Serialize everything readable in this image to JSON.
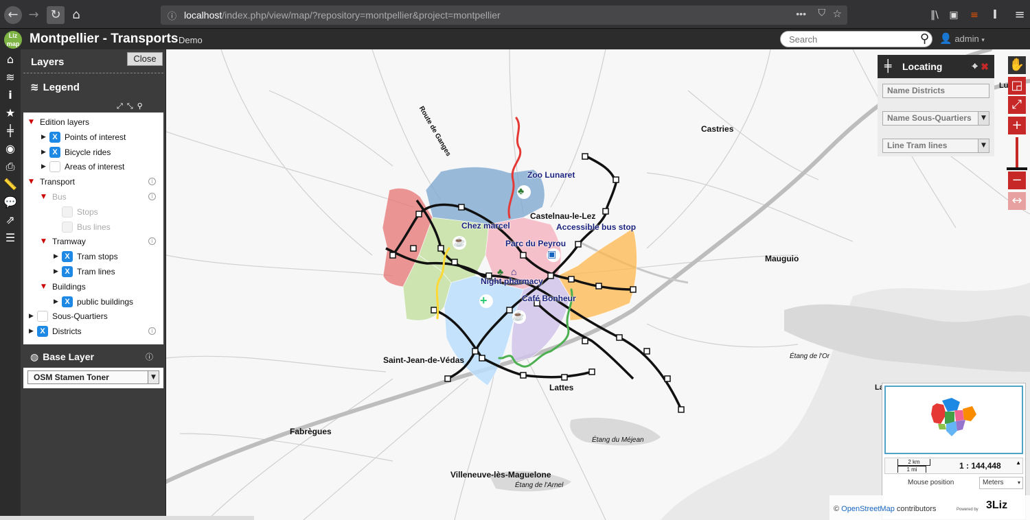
{
  "browser": {
    "url_host": "localhost",
    "url_path": "/index.php/view/map/?repository=montpellier&project=montpellier"
  },
  "app": {
    "logo_text": "Liz map",
    "title": "Montpellier - Transports",
    "subtitle": "Demo",
    "search_placeholder": "Search",
    "user": "admin"
  },
  "panel": {
    "title": "Layers",
    "close_label": "Close",
    "legend_title": "Legend",
    "tree": [
      {
        "label": "Edition layers",
        "level": 0,
        "state": "open",
        "checkbox": null,
        "info": false,
        "greyed": false
      },
      {
        "label": "Points of interest",
        "level": 1,
        "state": "closed",
        "checkbox": "on",
        "info": false,
        "greyed": false
      },
      {
        "label": "Bicycle rides",
        "level": 1,
        "state": "closed",
        "checkbox": "on",
        "info": false,
        "greyed": false
      },
      {
        "label": "Areas of interest",
        "level": 1,
        "state": "closed",
        "checkbox": "off",
        "info": false,
        "greyed": false
      },
      {
        "label": "Transport",
        "level": 0,
        "state": "open",
        "checkbox": null,
        "info": true,
        "greyed": false
      },
      {
        "label": "Bus",
        "level": 1,
        "state": "open",
        "checkbox": null,
        "info": true,
        "greyed": true
      },
      {
        "label": "Stops",
        "level": 2,
        "state": "none",
        "checkbox": "disabled",
        "info": false,
        "greyed": true
      },
      {
        "label": "Bus lines",
        "level": 2,
        "state": "none",
        "checkbox": "disabled",
        "info": false,
        "greyed": true
      },
      {
        "label": "Tramway",
        "level": 1,
        "state": "open",
        "checkbox": null,
        "info": true,
        "greyed": false
      },
      {
        "label": "Tram stops",
        "level": 2,
        "state": "closed",
        "checkbox": "on",
        "info": false,
        "greyed": false
      },
      {
        "label": "Tram lines",
        "level": 2,
        "state": "closed",
        "checkbox": "on",
        "info": false,
        "greyed": false
      },
      {
        "label": "Buildings",
        "level": 1,
        "state": "open",
        "checkbox": null,
        "info": false,
        "greyed": false
      },
      {
        "label": "public buildings",
        "level": 2,
        "state": "closed",
        "checkbox": "on",
        "info": false,
        "greyed": false
      },
      {
        "label": "Sous-Quartiers",
        "level": 0,
        "state": "closed",
        "checkbox": "off",
        "info": false,
        "greyed": false
      },
      {
        "label": "Districts",
        "level": 0,
        "state": "closed",
        "checkbox": "on",
        "info": true,
        "greyed": false
      }
    ],
    "base_layer_title": "Base Layer",
    "base_layer_value": "OSM Stamen Toner"
  },
  "locating": {
    "title": "Locating",
    "fields": [
      "Name Districts",
      "Name Sous-Quartiers",
      "Line Tram lines"
    ]
  },
  "map": {
    "places": [
      "Castries",
      "Mauguio",
      "Saint-Jean-de-Védas",
      "Lattes",
      "Fabrègues",
      "Villeneuve-lès-Maguelone",
      "Castelnau-le-Lez",
      "Route de Ganges",
      "Lunel",
      "La"
    ],
    "water": [
      "Étang de l'Or",
      "Étang du Méjean",
      "Étang de l'Arnel"
    ],
    "pois": [
      "Zoo Lunaret",
      "Chez marcel",
      "Parc du Peyrou",
      "Accessible bus stop",
      "Night pharmacy",
      "Café Bonheur"
    ]
  },
  "overview": {
    "scale_km": "2 km",
    "scale_mi": "1 mi",
    "scale_ratio": "1 : 144,448",
    "mouse_label": "Mouse position",
    "units": "Meters"
  },
  "attribution": {
    "prefix": "©",
    "osm": "OpenStreetMap",
    "suffix": "contributors",
    "powered": "Powered by",
    "brand": "3Liz"
  },
  "colors": {
    "accent_red": "#c62828",
    "checkbox_blue": "#1e88e5",
    "tram_black": "#111111"
  }
}
